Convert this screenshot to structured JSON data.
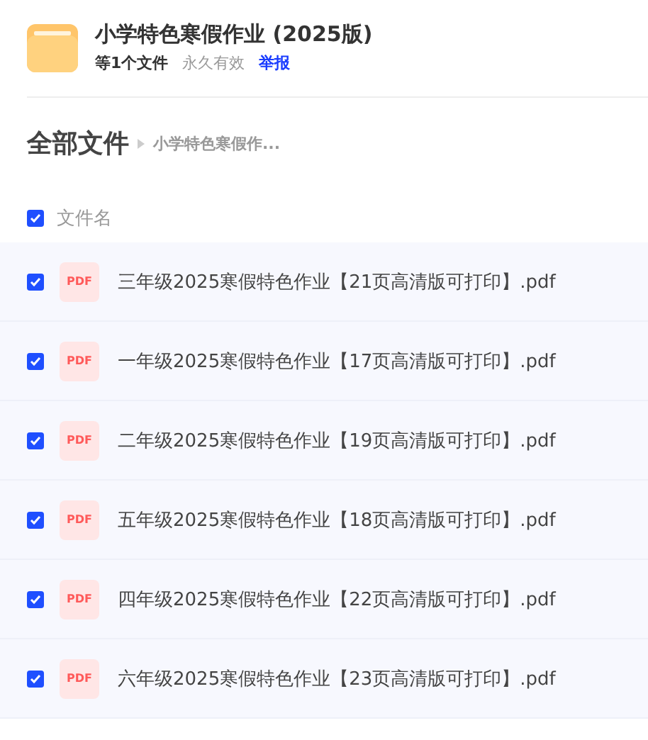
{
  "share": {
    "title": "小学特色寒假作业 (2025版)",
    "file_count": "等1个文件",
    "validity": "永久有效",
    "report_link": "举报"
  },
  "breadcrumb": {
    "root": "全部文件",
    "current": "小学特色寒假作..."
  },
  "file_list": {
    "header": {
      "label": "文件名",
      "checked": true
    },
    "rows": [
      {
        "name": "三年级2025寒假特色作业【21页高清版可打印】.pdf",
        "badge": "PDF",
        "checked": true
      },
      {
        "name": "一年级2025寒假特色作业【17页高清版可打印】.pdf",
        "badge": "PDF",
        "checked": true
      },
      {
        "name": "二年级2025寒假特色作业【19页高清版可打印】.pdf",
        "badge": "PDF",
        "checked": true
      },
      {
        "name": "五年级2025寒假特色作业【18页高清版可打印】.pdf",
        "badge": "PDF",
        "checked": true
      },
      {
        "name": "四年级2025寒假特色作业【22页高清版可打印】.pdf",
        "badge": "PDF",
        "checked": true
      },
      {
        "name": "六年级2025寒假特色作业【23页高清版可打印】.pdf",
        "badge": "PDF",
        "checked": true
      }
    ]
  }
}
